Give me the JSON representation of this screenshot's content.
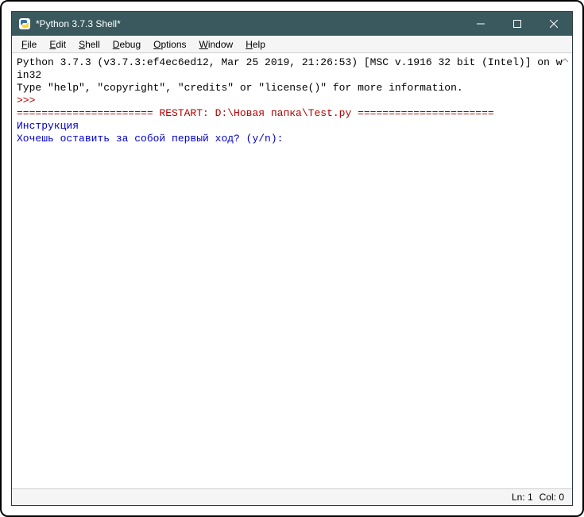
{
  "window": {
    "title": "*Python 3.7.3 Shell*"
  },
  "menubar": {
    "file": "File",
    "edit": "Edit",
    "shell": "Shell",
    "debug": "Debug",
    "options": "Options",
    "window": "Window",
    "help": "Help"
  },
  "shell": {
    "line1": "Python 3.7.3 (v3.7.3:ef4ec6ed12, Mar 25 2019, 21:26:53) [MSC v.1916 32 bit (Intel)] on win32",
    "line2": "Type \"help\", \"copyright\", \"credits\" or \"license()\" for more information.",
    "prompt": ">>> ",
    "restart": "====================== RESTART: D:\\Новая папка\\Test.py ======================",
    "out1": "Инструкция",
    "out2": "Хочешь оставить за собой первый ход? (y/n): "
  },
  "status": {
    "ln": "Ln: 1",
    "col": "Col: 0"
  }
}
